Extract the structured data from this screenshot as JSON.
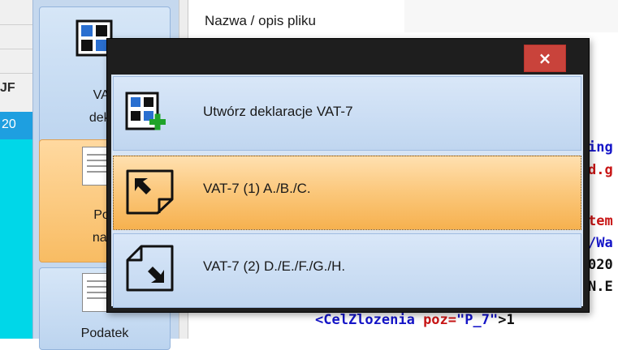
{
  "background": {
    "column_header": "Nazwa / opis pliku",
    "left_column_code": "JF",
    "left_column_row": "20",
    "side_buttons": [
      {
        "label_line1": "VAT",
        "label_line2": "dekla"
      },
      {
        "label_line1": "Poc",
        "label_line2": "nale"
      },
      {
        "label_line1": "Podatek",
        "label_line2": ""
      }
    ],
    "code_fragments": [
      {
        "text": "ing",
        "color": "#1515c8"
      },
      {
        "text": "d.g",
        "color": "#c81515"
      },
      {
        "text": "tem",
        "color": "#c81515"
      },
      {
        "text": "/Wa",
        "color": "#1515c8"
      },
      {
        "text": "020",
        "color": "#111111"
      },
      {
        "text": "N.E",
        "color": "#111111"
      }
    ],
    "code_last_line": {
      "tag": "<CelZlozenia",
      "attr": " poz=",
      "value": "\"P_7\"",
      "rest": ">1"
    }
  },
  "dialog": {
    "close_label": "×",
    "items": [
      {
        "label": "Utwórz deklaracje VAT-7",
        "icon": "create-declaration-icon",
        "selected": false
      },
      {
        "label": "VAT-7 (1) A./B./C.",
        "icon": "arrow-up-left-icon",
        "selected": true
      },
      {
        "label": "VAT-7 (2) D./E./F./G./H.",
        "icon": "arrow-down-right-icon",
        "selected": false
      }
    ]
  },
  "colors": {
    "accent_blue": "#c0d6f0",
    "selected_orange": "#fbc77a",
    "close_red": "#c9433b",
    "dialog_frame": "#1e1e1e",
    "icon_green": "#1fa329"
  }
}
